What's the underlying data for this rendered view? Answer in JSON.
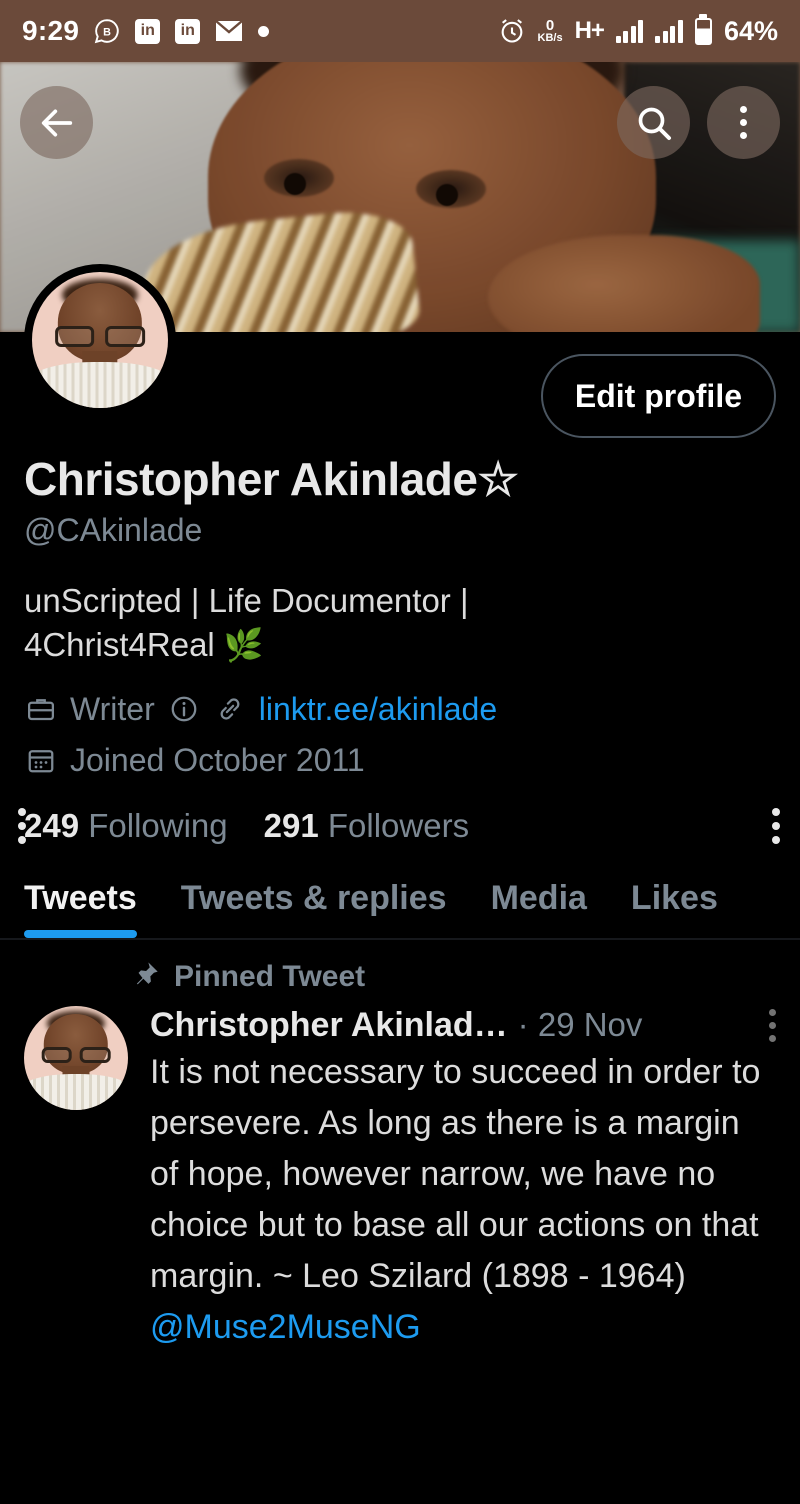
{
  "statusbar": {
    "time": "9:29",
    "icons_left": [
      "whatsapp-business-icon",
      "linkedin-icon",
      "linkedin-icon",
      "mail-icon",
      "dot-icon"
    ],
    "linkedin_label": "in",
    "network_speed_value": "0",
    "network_speed_unit": "KB/s",
    "network_type": "H+",
    "battery_percent": "64%",
    "bg_color": "#6b4a3a"
  },
  "header": {
    "back_icon": "arrow-left-icon",
    "search_icon": "search-icon",
    "overflow_icon": "more-vertical-icon"
  },
  "profile": {
    "edit_button": "Edit profile",
    "display_name": "Christopher Akinlade",
    "name_star": "☆",
    "handle": "@CAkinlade",
    "bio_line1": "unScripted | Life Documentor |",
    "bio_line2": "4Christ4Real",
    "bio_emoji": "🌿",
    "profession": "Writer",
    "profession_icon": "briefcase-icon",
    "info_icon": "info-circle-icon",
    "link_icon": "link-icon",
    "link_text": "linktr.ee/akinlade",
    "joined_icon": "calendar-icon",
    "joined": "Joined October 2011",
    "following_count": "249",
    "following_label": "Following",
    "followers_count": "291",
    "followers_label": "Followers",
    "link_color": "#1d9bf0"
  },
  "tabs": [
    {
      "label": "Tweets",
      "active": true
    },
    {
      "label": "Tweets & replies",
      "active": false
    },
    {
      "label": "Media",
      "active": false
    },
    {
      "label": "Likes",
      "active": false
    }
  ],
  "tweet": {
    "pinned_icon": "pin-icon",
    "pinned_label": "Pinned Tweet",
    "author": "Christopher Akinlad…",
    "date_separator": "·",
    "date": "29 Nov",
    "overflow_icon": "more-vertical-icon",
    "text": "It is not necessary to succeed in order to persevere. As long as there is a margin of hope, however narrow, we have no choice but to base all our actions on that margin.\n~ Leo Szilard (1898 - 1964)\n",
    "mention": "@Muse2MuseNG"
  },
  "colors": {
    "accent": "#1d9bf0",
    "background": "#000000",
    "muted_text": "#7d8994",
    "primary_text": "#e8e8e8"
  }
}
